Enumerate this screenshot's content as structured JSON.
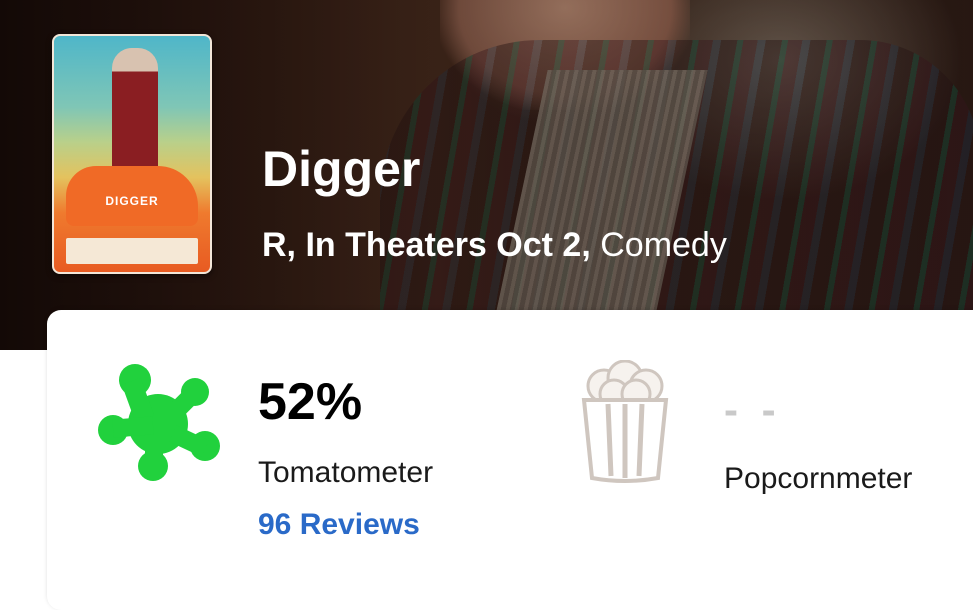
{
  "movie": {
    "title": "Digger",
    "rating": "R,",
    "release": "In Theaters Oct 2,",
    "genre": "Comedy",
    "poster_title": "DIGGER"
  },
  "tomatometer": {
    "score": "52%",
    "label": "Tomatometer",
    "reviews": "96 Reviews",
    "icon": "green-splat-icon",
    "color": "#21d13d"
  },
  "popcornmeter": {
    "score": "- -",
    "label": "Popcornmeter",
    "icon": "empty-popcorn-bucket-icon"
  },
  "colors": {
    "link": "#2a6ac8",
    "placeholder_score": "#c9c9c9"
  }
}
